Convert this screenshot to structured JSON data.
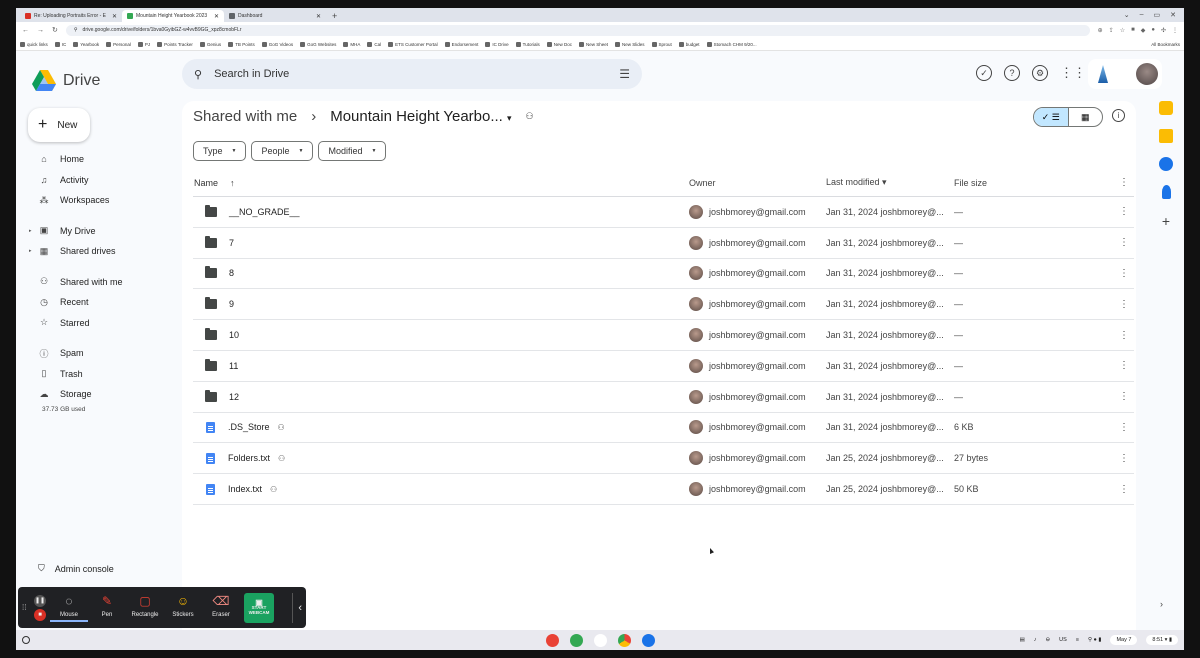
{
  "browser": {
    "tabs": [
      {
        "title": "Re: Uploading Portraits Error - E",
        "favicon_color": "#d93025",
        "active": false
      },
      {
        "title": "Mountain Height Yearbook 2023",
        "favicon_color": "#34a853",
        "active": true
      },
      {
        "title": "Dashboard",
        "favicon_color": "#5f6368",
        "active": false
      }
    ],
    "new_tab": "+",
    "url": "drive.google.com/drive/folders/1bva0GyibGZ-w4vvB9GG_xpz8cmobFLr",
    "bookmarks": [
      "quick links",
      "IC",
      "Yearbook",
      "Personal",
      "PJ",
      "Points Tracker",
      "Genius",
      "TB Points",
      "GoG Videos",
      "GoG Websites",
      "MHA",
      "Cal",
      "ETS Customer Portal",
      "Endorsement",
      "IC Drive",
      "Tutorials",
      "New Doc",
      "New Sheet",
      "New Slides",
      "Sprout",
      "budget",
      "Stomach CHM 9/20..."
    ],
    "all_bookmarks": "All Bookmarks"
  },
  "drive": {
    "app_name": "Drive",
    "search_placeholder": "Search in Drive",
    "new_label": "New",
    "nav": [
      {
        "label": "Home",
        "icon": "home-icon",
        "glyph": "⌂"
      },
      {
        "label": "Activity",
        "icon": "bell-icon",
        "glyph": "♫"
      },
      {
        "label": "Workspaces",
        "icon": "workspaces-icon",
        "glyph": "⁂"
      },
      {
        "label": "My Drive",
        "icon": "my-drive-icon",
        "glyph": "▣"
      },
      {
        "label": "Shared drives",
        "icon": "shared-drives-icon",
        "glyph": "▦"
      },
      {
        "label": "Shared with me",
        "icon": "people-icon",
        "glyph": "⚇"
      },
      {
        "label": "Recent",
        "icon": "clock-icon",
        "glyph": "◷"
      },
      {
        "label": "Starred",
        "icon": "star-icon",
        "glyph": "☆"
      },
      {
        "label": "Spam",
        "icon": "spam-icon",
        "glyph": "ⓘ"
      },
      {
        "label": "Trash",
        "icon": "trash-icon",
        "glyph": "▯"
      },
      {
        "label": "Storage",
        "icon": "cloud-icon",
        "glyph": "☁"
      }
    ],
    "storage_used": "37.73 GB used",
    "admin_console": "Admin console",
    "breadcrumb": {
      "parent": "Shared with me",
      "separator": "›",
      "current": "Mountain Height Yearbo..."
    },
    "filters": [
      "Type",
      "People",
      "Modified"
    ],
    "columns": {
      "name": "Name",
      "owner": "Owner",
      "modified": "Last modified",
      "size": "File size"
    },
    "files": [
      {
        "name": "__NO_GRADE__",
        "type": "folder",
        "shared": false,
        "owner": "joshbmorey@gmail.com",
        "modified": "Jan 31, 2024 joshbmorey@...",
        "size": "—"
      },
      {
        "name": "7",
        "type": "folder",
        "shared": false,
        "owner": "joshbmorey@gmail.com",
        "modified": "Jan 31, 2024 joshbmorey@...",
        "size": "—"
      },
      {
        "name": "8",
        "type": "folder",
        "shared": false,
        "owner": "joshbmorey@gmail.com",
        "modified": "Jan 31, 2024 joshbmorey@...",
        "size": "—"
      },
      {
        "name": "9",
        "type": "folder",
        "shared": false,
        "owner": "joshbmorey@gmail.com",
        "modified": "Jan 31, 2024 joshbmorey@...",
        "size": "—"
      },
      {
        "name": "10",
        "type": "folder",
        "shared": false,
        "owner": "joshbmorey@gmail.com",
        "modified": "Jan 31, 2024 joshbmorey@...",
        "size": "—"
      },
      {
        "name": "11",
        "type": "folder",
        "shared": false,
        "owner": "joshbmorey@gmail.com",
        "modified": "Jan 31, 2024 joshbmorey@...",
        "size": "—"
      },
      {
        "name": "12",
        "type": "folder",
        "shared": false,
        "owner": "joshbmorey@gmail.com",
        "modified": "Jan 31, 2024 joshbmorey@...",
        "size": "—"
      },
      {
        "name": ".DS_Store",
        "type": "file",
        "shared": true,
        "owner": "joshbmorey@gmail.com",
        "modified": "Jan 31, 2024 joshbmorey@...",
        "size": "6 KB"
      },
      {
        "name": "Folders.txt",
        "type": "file",
        "shared": true,
        "owner": "joshbmorey@gmail.com",
        "modified": "Jan 25, 2024 joshbmorey@...",
        "size": "27 bytes"
      },
      {
        "name": "Index.txt",
        "type": "file",
        "shared": true,
        "owner": "joshbmorey@gmail.com",
        "modified": "Jan 25, 2024 joshbmorey@...",
        "size": "50 KB"
      }
    ]
  },
  "screencast_toolbar": {
    "tools": [
      {
        "label": "Mouse",
        "glyph": "◌",
        "icon": "mouse-icon",
        "selected": true
      },
      {
        "label": "Pen",
        "glyph": "✎",
        "icon": "pen-icon",
        "selected": false
      },
      {
        "label": "Rectangle",
        "glyph": "▢",
        "icon": "rectangle-icon",
        "selected": false
      },
      {
        "label": "Stickers",
        "glyph": "☺",
        "icon": "sticker-icon",
        "selected": false
      },
      {
        "label": "Eraser",
        "glyph": "⌫",
        "icon": "eraser-icon",
        "selected": false
      }
    ],
    "webcam_label": "START WEBCAM"
  },
  "shelf": {
    "locale": "US",
    "date": "May 7",
    "time": "8:51"
  },
  "colors": {
    "accent": "#0b57d0",
    "selected_toggle": "#c2e7ff",
    "webcam_green": "#1aa260"
  }
}
